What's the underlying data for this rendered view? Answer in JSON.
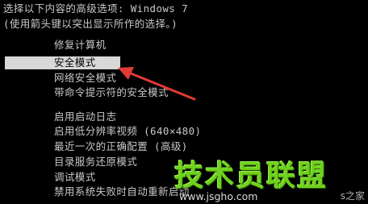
{
  "header": {
    "line1": "选择以下内容的高级选项: Windows 7",
    "line2": "(使用箭头键以突出显示所作的选择。)"
  },
  "options": [
    "修复计算机",
    "安全模式",
    "网络安全模式",
    "带命令提示符的安全模式",
    "启用启动日志",
    "启用低分辨率视频 (640×480)",
    "最近一次的正确配置 (高级)",
    "目录服务还原模式",
    "调试模式",
    "禁用系统失败时自动重新启动"
  ],
  "selected_option": "安全模式",
  "watermark": {
    "title": "技术员联盟",
    "url": "www.jsgho.com",
    "sub": "s之家"
  },
  "colors": {
    "background": "#000000",
    "text": "#c8c8c8",
    "highlight": "#d8d8d8",
    "arrow": "#e23a35",
    "watermark": "#6fd21d"
  }
}
